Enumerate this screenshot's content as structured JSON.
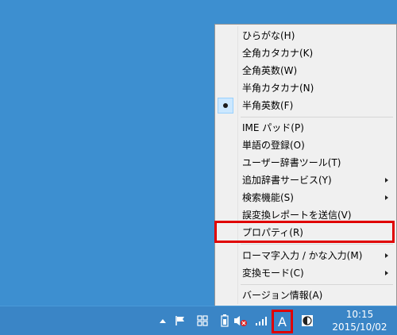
{
  "menu": {
    "items": [
      {
        "label": "ひらがな(H)"
      },
      {
        "label": "全角カタカナ(K)"
      },
      {
        "label": "全角英数(W)"
      },
      {
        "label": "半角カタカナ(N)"
      },
      {
        "label": "半角英数(F)",
        "checked": true
      },
      {
        "label": "IME パッド(P)"
      },
      {
        "label": "単語の登録(O)"
      },
      {
        "label": "ユーザー辞書ツール(T)"
      },
      {
        "label": "追加辞書サービス(Y)",
        "submenu": true
      },
      {
        "label": "検索機能(S)",
        "submenu": true
      },
      {
        "label": "誤変換レポートを送信(V)"
      },
      {
        "label": "プロパティ(R)",
        "highlighted": true
      },
      {
        "label": "ローマ字入力 / かな入力(M)",
        "submenu": true
      },
      {
        "label": "変換モード(C)",
        "submenu": true
      },
      {
        "label": "バージョン情報(A)"
      }
    ]
  },
  "taskbar": {
    "ime_indicator": "A",
    "clock_time": "10:15",
    "clock_date": "2015/10/02",
    "tray_icons": [
      "show-hidden-icons-chevron",
      "action-center-flag",
      "windows-icon",
      "battery-icon",
      "volume-muted-icon",
      "network-signal-icon",
      "ime-mode-icon",
      "ime-toggle-icon"
    ]
  },
  "colors": {
    "desktop": "#3d8fd0",
    "taskbar": "#3a85c6",
    "highlight_border": "#e00000",
    "menu_bg": "#f0f0f0"
  }
}
